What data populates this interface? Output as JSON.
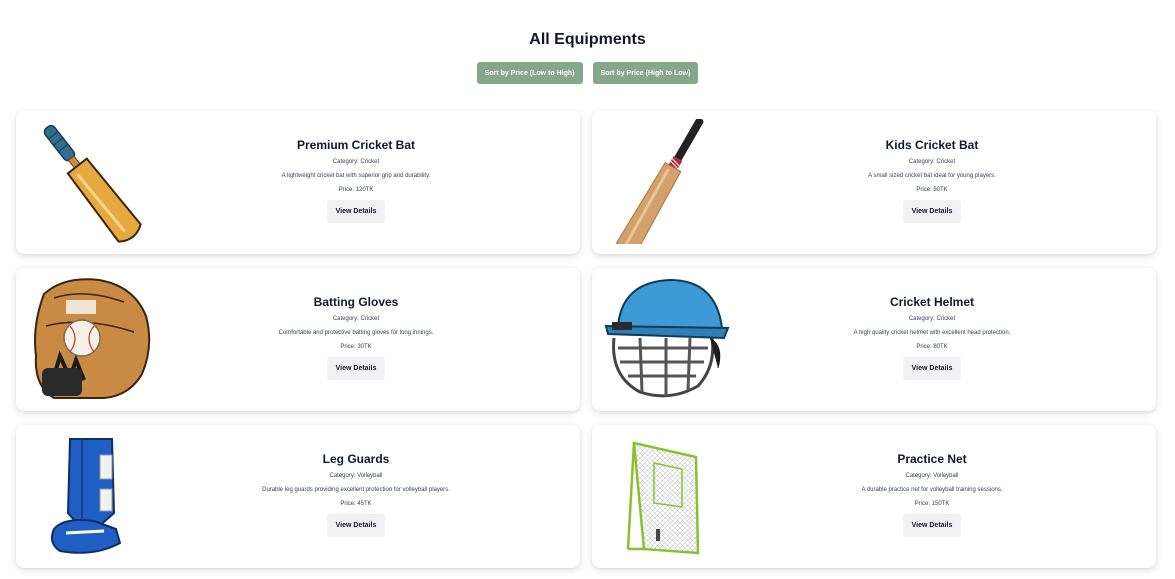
{
  "page": {
    "title": "All Equipments"
  },
  "sort": {
    "low_to_high": "Sort by Price (Low to High)",
    "high_to_low": "Sort by Price (High to Low)"
  },
  "button_color": "#86a88a",
  "products": [
    {
      "name": "Premium Cricket Bat",
      "category": "Category: Cricket",
      "description": "A lightweight cricket bat with superior grip and durability.",
      "price": "Price: 120TK",
      "button": "View Details",
      "image": "cricket-bat-icon"
    },
    {
      "name": "Kids Cricket Bat",
      "category": "Category: Cricket",
      "description": "A small sized cricket bat ideal for young players.",
      "price": "Price: 50TK",
      "button": "View Details",
      "image": "kids-cricket-bat-icon"
    },
    {
      "name": "Batting Gloves",
      "category": "Category: Cricket",
      "description": "Comfortable and protective batting gloves for long innings.",
      "price": "Price: 30TK",
      "button": "View Details",
      "image": "glove-icon"
    },
    {
      "name": "Cricket Helmet",
      "category": "Category: Cricket",
      "description": "A high quality cricket helmet with excellent head protection.",
      "price": "Price: 80TK",
      "button": "View Details",
      "image": "helmet-icon"
    },
    {
      "name": "Leg Guards",
      "category": "Category: Volleyball",
      "description": "Durable leg guards providing excellent protection for volleyball players.",
      "price": "Price: 45TK",
      "button": "View Details",
      "image": "leg-guard-icon"
    },
    {
      "name": "Practice Net",
      "category": "Category: Volleyball",
      "description": "A durable practice net for volleyball training sessions.",
      "price": "Price: 150TK",
      "button": "View Details",
      "image": "practice-net-icon"
    }
  ]
}
